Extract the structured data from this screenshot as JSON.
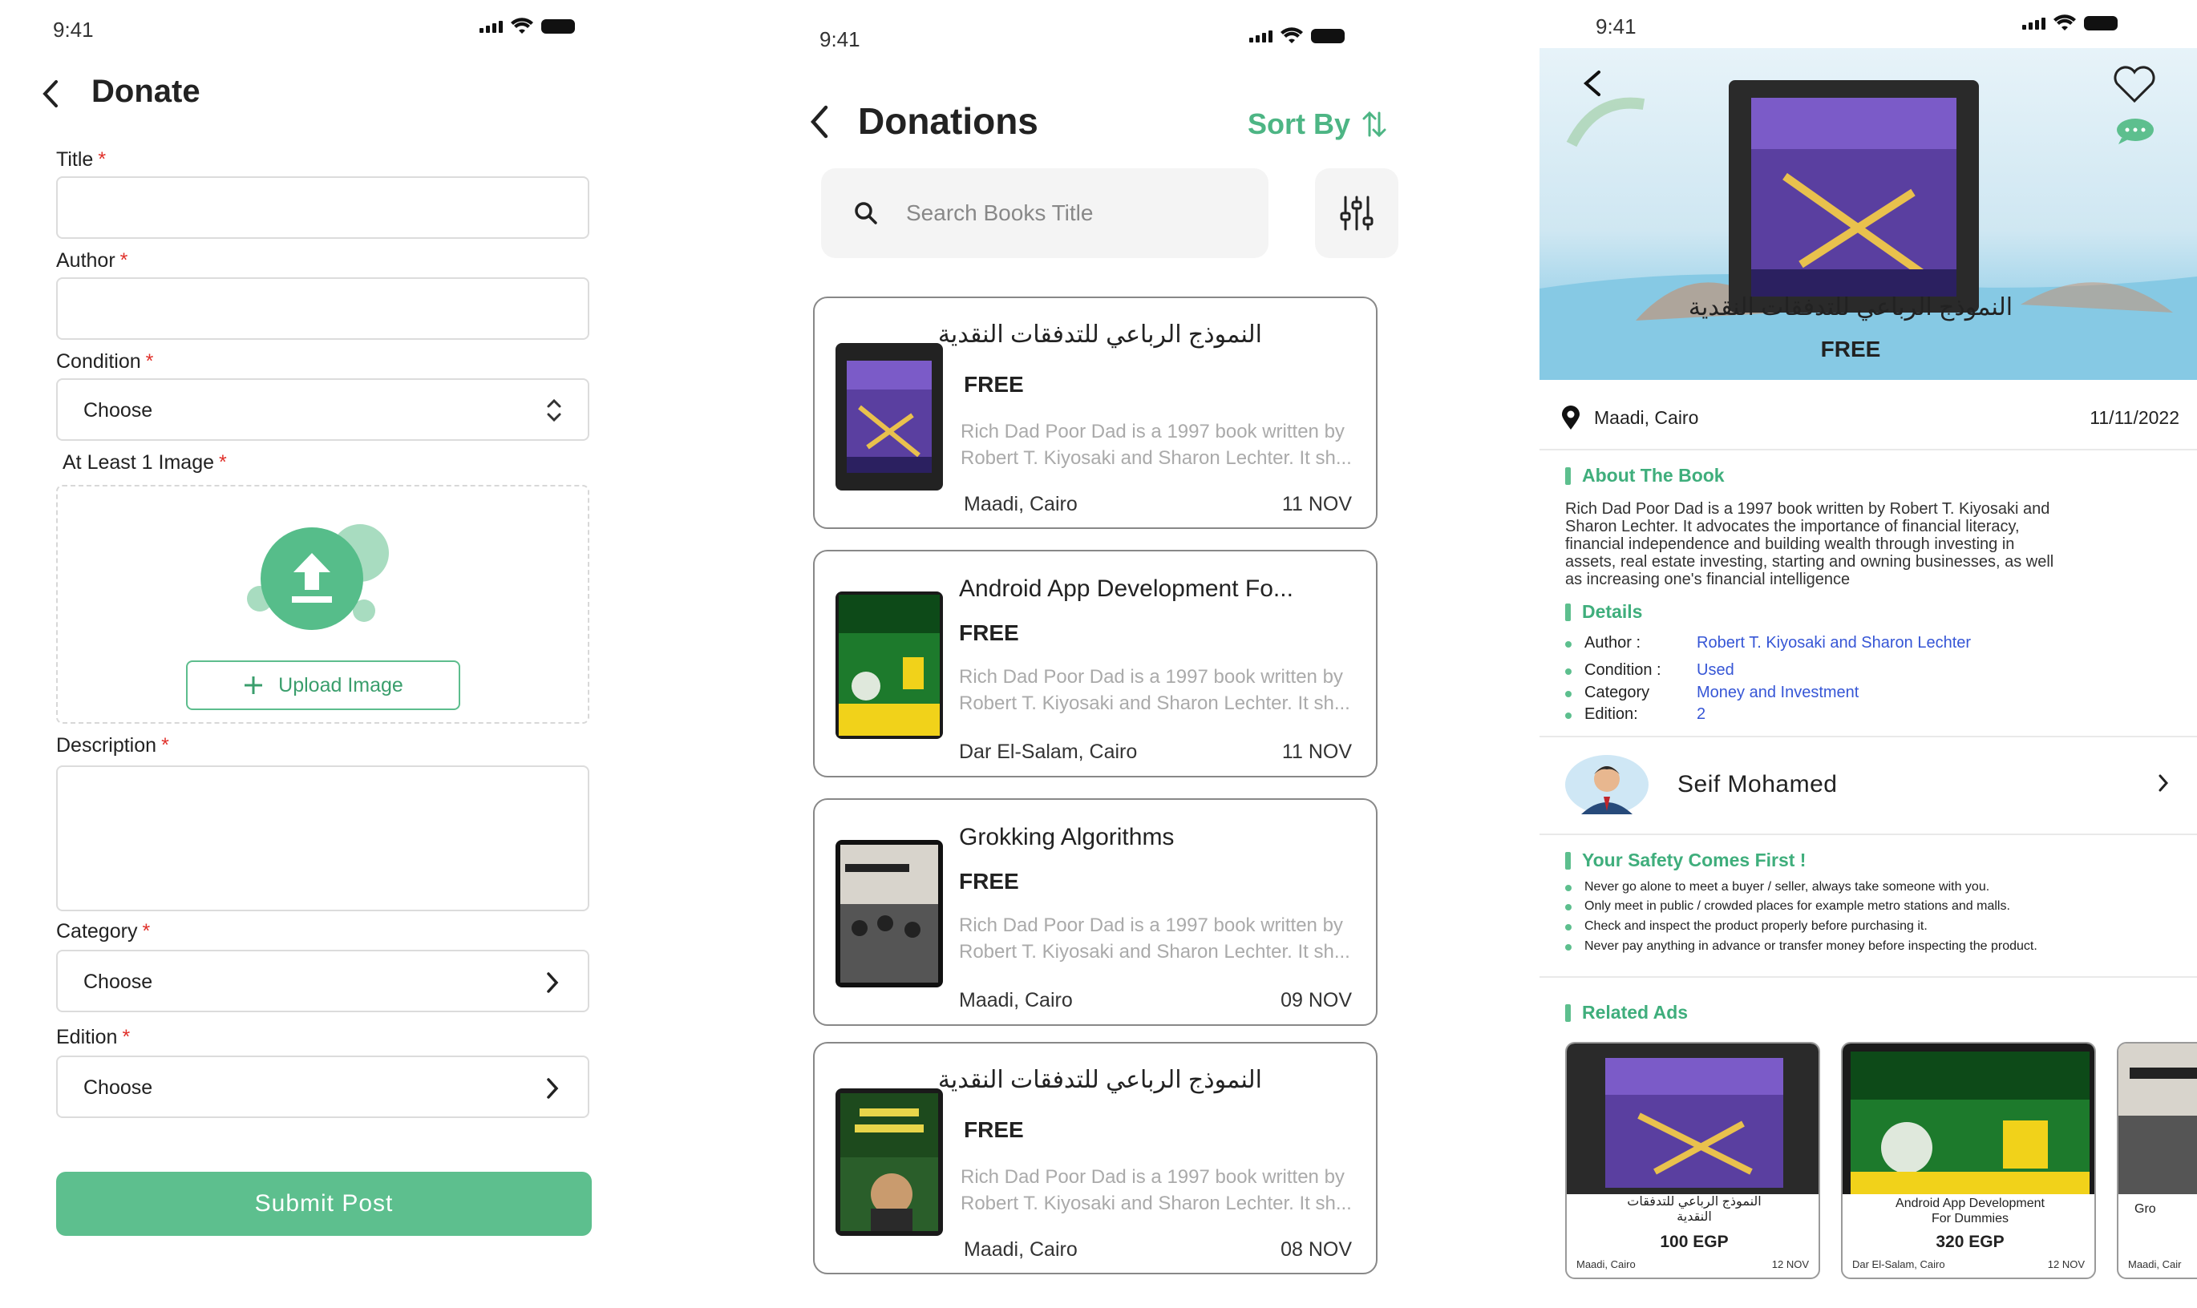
{
  "status": {
    "time": "9:41"
  },
  "donate": {
    "title": "Donate",
    "fields": {
      "title_label": "Title",
      "author_label": "Author",
      "condition_label": "Condition",
      "condition_value": "Choose",
      "image_label": "At Least 1 Image",
      "upload_label": "Upload Image",
      "description_label": "Description",
      "category_label": "Category",
      "category_value": "Choose",
      "edition_label": "Edition",
      "edition_value": "Choose",
      "required_mark": "*"
    },
    "submit_label": "Submit Post"
  },
  "donations": {
    "title": "Donations",
    "sort_label": "Sort By",
    "search_placeholder": "Search Books Title",
    "items": [
      {
        "title": "النموذج الرباعي للتدفقات النقدية",
        "price": "FREE",
        "desc1": "Rich Dad Poor Dad is a 1997 book written by",
        "desc2": "Robert T. Kiyosaki and Sharon Lechter. It sh...",
        "location": "Maadi, Cairo",
        "date": "11 NOV"
      },
      {
        "title": "Android App Development Fo...",
        "price": "FREE",
        "desc1": "Rich Dad Poor Dad is a 1997 book written by",
        "desc2": "Robert T. Kiyosaki and Sharon Lechter. It sh...",
        "location": "Dar El-Salam, Cairo",
        "date": "11 NOV"
      },
      {
        "title": "Grokking Algorithms",
        "price": "FREE",
        "desc1": "Rich Dad Poor Dad is a 1997 book written by",
        "desc2": "Robert T. Kiyosaki and Sharon Lechter. It sh...",
        "location": "Maadi, Cairo",
        "date": "09 NOV"
      },
      {
        "title": "النموذج الرباعي للتدفقات النقدية",
        "price": "FREE",
        "desc1": "Rich Dad Poor Dad is a 1997 book written by",
        "desc2": "Robert T. Kiyosaki and Sharon Lechter. It sh...",
        "location": "Maadi, Cairo",
        "date": "08 NOV"
      }
    ]
  },
  "detail": {
    "book_title": "النموذج الرباعي للتدفقات النقدية",
    "price": "FREE",
    "location": "Maadi, Cairo",
    "date": "11/11/2022",
    "about_heading": "About The Book",
    "about_lines": [
      "Rich Dad Poor Dad is a 1997 book written by Robert T. Kiyosaki and",
      "Sharon Lechter. It advocates the importance of financial literacy,",
      "financial independence and building wealth through investing in",
      "assets, real estate investing, starting and owning businesses, as well",
      "as increasing one's financial intelligence"
    ],
    "details_heading": "Details",
    "details": {
      "author_label": "Author :",
      "author_value": "Robert T. Kiyosaki and Sharon Lechter",
      "condition_label": "Condition :",
      "condition_value": "Used",
      "category_label": "Category",
      "category_value": "Money and Investment",
      "edition_label": "Edition:",
      "edition_value": "2"
    },
    "seller_name": "Seif Mohamed",
    "safety_heading": "Your Safety Comes First !",
    "safety_tips": [
      "Never go alone to meet a buyer / seller, always take someone with you.",
      "Only meet in public / crowded places for example metro stations and malls.",
      "Check and inspect the product properly before purchasing it.",
      "Never pay anything in advance or transfer money before inspecting the product."
    ],
    "related_heading": "Related Ads",
    "related": [
      {
        "title1": "النموذج الرباعي للتدفقات",
        "title2": "النقدية",
        "price": "100 EGP",
        "location": "Maadi, Cairo",
        "date": "12 NOV"
      },
      {
        "title1": "Android App Development",
        "title2": "For Dummies",
        "price": "320 EGP",
        "location": "Dar El-Salam, Cairo",
        "date": "12 NOV"
      },
      {
        "title1": "Gro",
        "title2": "",
        "price": "",
        "location": "Maadi, Cair",
        "date": ""
      }
    ]
  },
  "colors": {
    "accent": "#5dbf8e",
    "link": "#3656d6",
    "required": "#e0302a"
  }
}
